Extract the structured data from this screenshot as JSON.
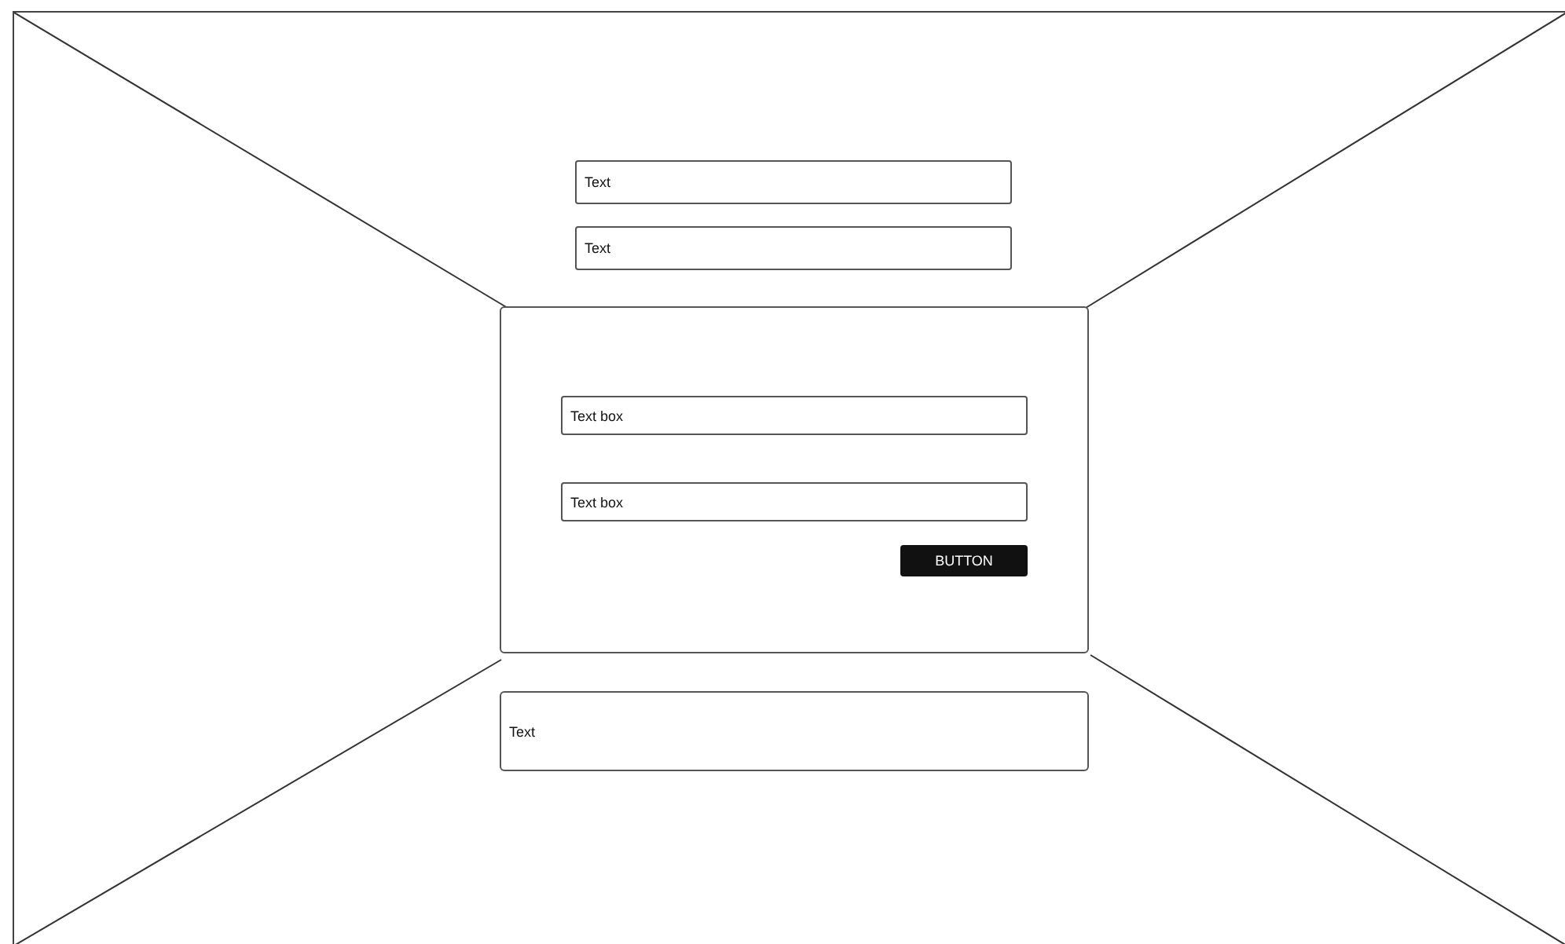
{
  "top_fields": [
    {
      "value": "Text"
    },
    {
      "value": "Text"
    }
  ],
  "panel": {
    "fields": [
      {
        "value": "Text box"
      },
      {
        "value": "Text box"
      }
    ],
    "button": "BUTTON"
  },
  "bottom_box": {
    "text": "Text"
  }
}
